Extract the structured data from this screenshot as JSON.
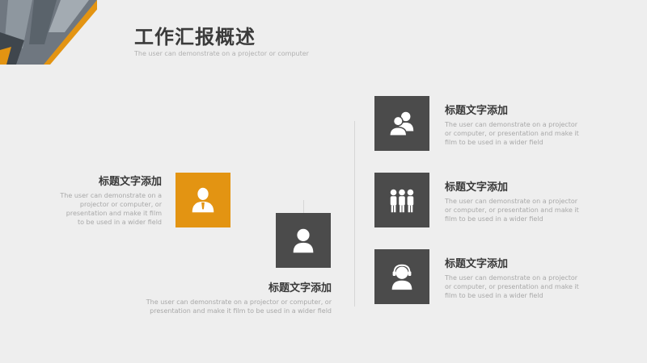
{
  "header": {
    "title": "工作汇报概述",
    "subtitle": "The user can demonstrate on a projector or computer"
  },
  "colors": {
    "accent": "#e39412",
    "dark_box": "#4b4b4b",
    "background": "#eeeeee"
  },
  "left_item": {
    "icon": "businessman-icon",
    "title": "标题文字添加",
    "desc": [
      "The user can demonstrate on a",
      "projector or computer, or",
      "presentation and make it film",
      "to be used in a wider field"
    ]
  },
  "center_item": {
    "icon": "person-icon",
    "title": "标题文字添加",
    "desc": [
      "The user can demonstrate on a projector or computer, or",
      "presentation and make it film to be used in a wider field"
    ]
  },
  "right_items": [
    {
      "icon": "two-people-icon",
      "title": "标题文字添加",
      "desc": [
        "The user can demonstrate on a projector",
        "or computer, or presentation and make it",
        "film to be used in a wider field"
      ]
    },
    {
      "icon": "team-icon",
      "title": "标题文字添加",
      "desc": [
        "The user can demonstrate on a projector",
        "or computer, or presentation and make it",
        "film to be used in a wider field"
      ]
    },
    {
      "icon": "headset-person-icon",
      "title": "标题文字添加",
      "desc": [
        "The user can demonstrate on a projector",
        "or computer, or presentation and make it",
        "film to be used in a wider field"
      ]
    }
  ]
}
